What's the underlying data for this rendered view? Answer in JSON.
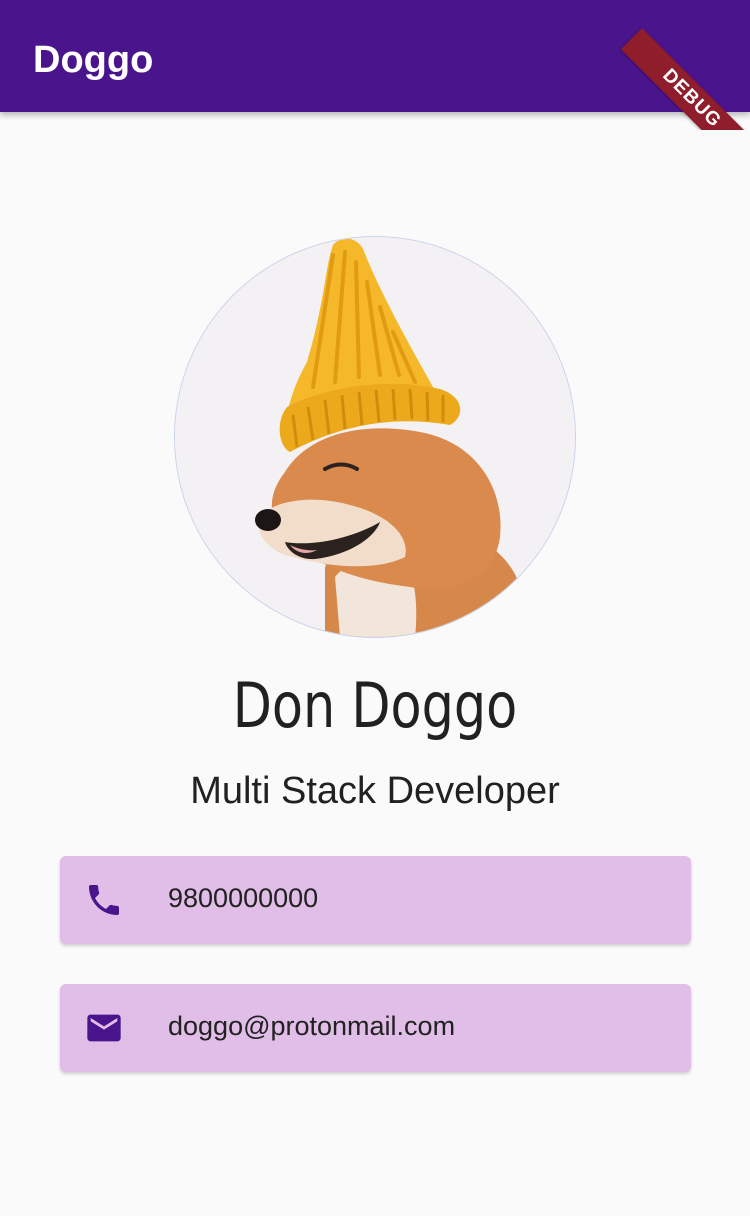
{
  "app": {
    "title": "Doggo",
    "debug_banner": "DEBUG"
  },
  "profile": {
    "avatar_alt": "Shiba Inu dog wearing a yellow knit beanie",
    "name": "Don Doggo",
    "role": "Multi Stack Developer"
  },
  "contacts": {
    "phone": {
      "icon": "phone-icon",
      "value": "9800000000"
    },
    "email": {
      "icon": "email-icon",
      "value": "doggo@protonmail.com"
    }
  },
  "colors": {
    "primary": "#4a148c",
    "card_background": "#e1bee7",
    "page_background": "#fafafa",
    "debug_banner": "#8f1d2c"
  }
}
